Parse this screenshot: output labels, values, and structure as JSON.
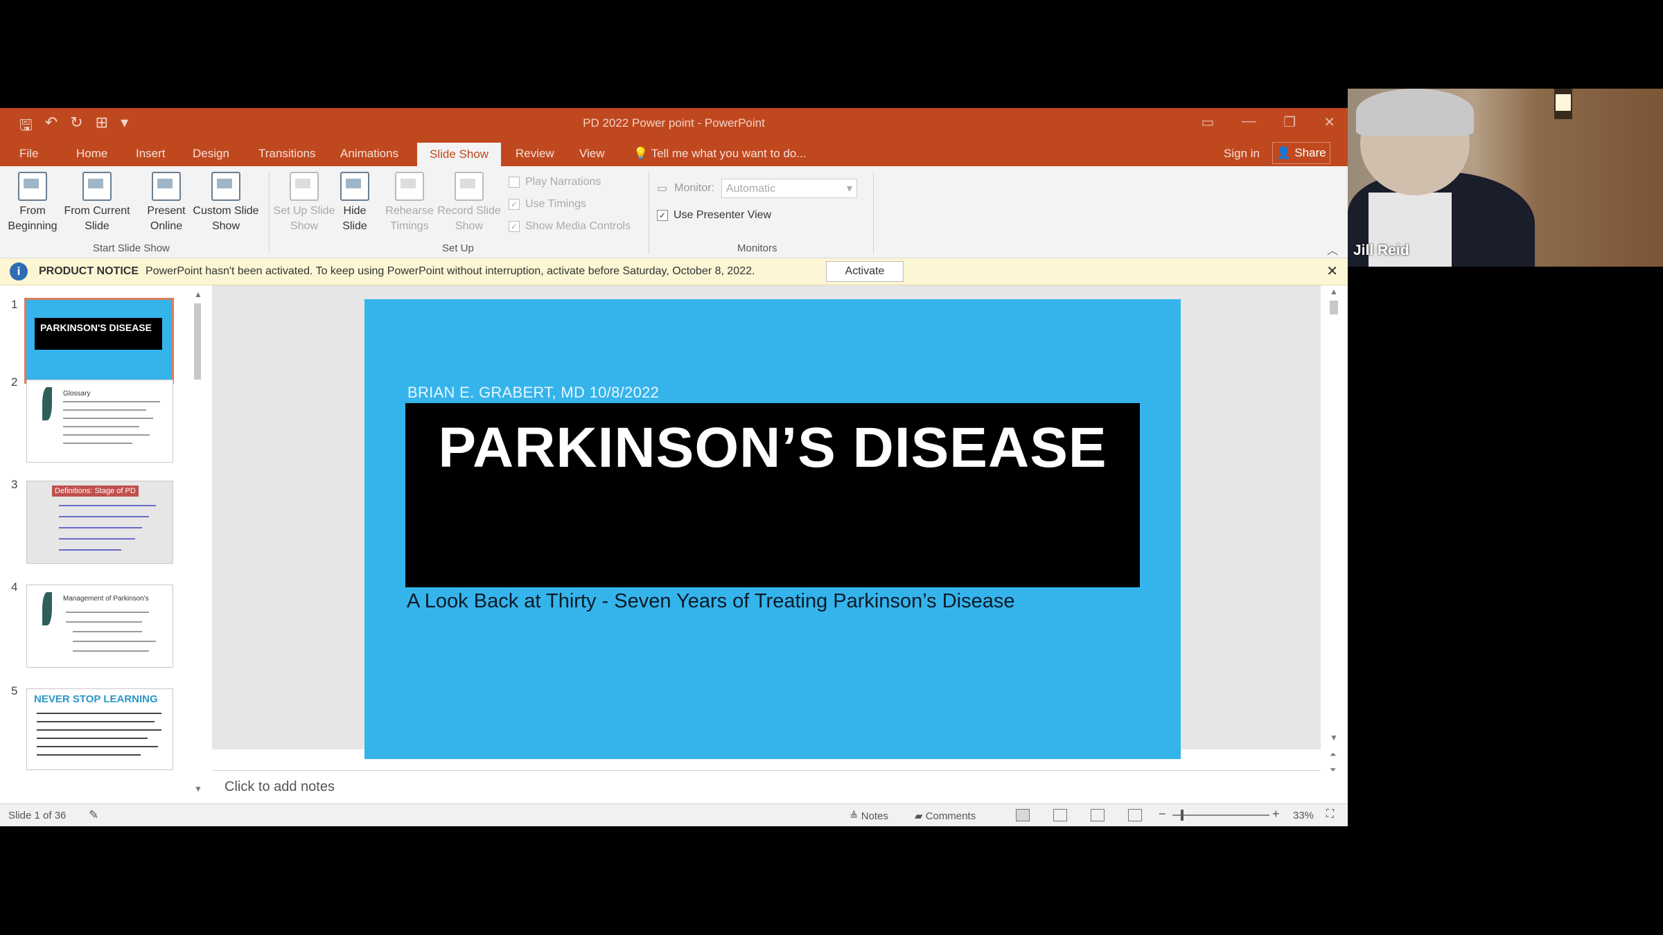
{
  "window": {
    "title": "PD 2022 Power point - PowerPoint"
  },
  "tabs": [
    {
      "label": "File"
    },
    {
      "label": "Home"
    },
    {
      "label": "Insert"
    },
    {
      "label": "Design"
    },
    {
      "label": "Transitions"
    },
    {
      "label": "Animations"
    },
    {
      "label": "Slide Show"
    },
    {
      "label": "Review"
    },
    {
      "label": "View"
    }
  ],
  "tell_me": "Tell me what you want to do...",
  "sign_in": "Sign in",
  "share": "Share",
  "ribbon": {
    "from_beginning": "From Beginning",
    "from_current": "From Current Slide",
    "present_online": "Present Online",
    "custom_show": "Custom Slide Show",
    "group_start": "Start Slide Show",
    "setup_show": "Set Up Slide Show",
    "hide_slide": "Hide Slide",
    "rehearse": "Rehearse Timings",
    "record": "Record Slide Show",
    "play_narrations": "Play Narrations",
    "use_timings": "Use Timings",
    "show_media": "Show Media Controls",
    "group_setup": "Set Up",
    "monitor_label": "Monitor:",
    "monitor_value": "Automatic",
    "presenter_view": "Use Presenter View",
    "group_monitors": "Monitors"
  },
  "notice": {
    "title": "PRODUCT NOTICE",
    "text": "PowerPoint hasn't been activated. To keep using PowerPoint without interruption, activate before Saturday, October 8, 2022.",
    "button": "Activate"
  },
  "thumbnails": [
    {
      "num": "1",
      "label": "PARKINSON'S DISEASE"
    },
    {
      "num": "2",
      "label": "Glossary"
    },
    {
      "num": "3",
      "label": "Definitions: Stage of PD"
    },
    {
      "num": "4",
      "label": "Management of Parkinson's"
    },
    {
      "num": "5",
      "label": "NEVER STOP LEARNING"
    }
  ],
  "slide": {
    "author": "BRIAN E. GRABERT, MD   10/8/2022",
    "title": "PARKINSON’S DISEASE",
    "subtitle": "A Look Back at Thirty - Seven Years of Treating Parkinson’s Disease"
  },
  "notes_placeholder": "Click to add notes",
  "status": {
    "slide_count": "Slide 1 of 36",
    "notes": "Notes",
    "comments": "Comments",
    "zoom": "33%"
  },
  "webcam": {
    "name": "Jill Reid"
  },
  "colors": {
    "ribbon": "#c0481f",
    "slide_bg": "#35b4ec",
    "notice_bg": "#fcf6d4"
  }
}
